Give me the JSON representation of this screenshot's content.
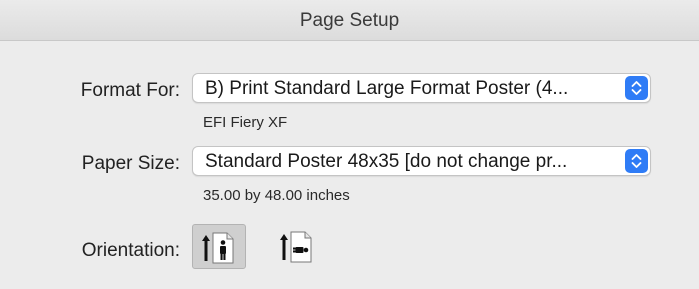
{
  "window": {
    "title": "Page Setup"
  },
  "format_for": {
    "label": "Format For:",
    "value": "B) Print Standard Large Format Poster (4...",
    "sub_text": "EFI Fiery XF"
  },
  "paper_size": {
    "label": "Paper Size:",
    "value": "Standard Poster 48x35 [do not change pr...",
    "sub_text": "35.00 by 48.00 inches"
  },
  "orientation": {
    "label": "Orientation:",
    "options": [
      {
        "name": "portrait",
        "selected": true,
        "icon": "portrait-orientation-icon"
      },
      {
        "name": "landscape",
        "selected": false,
        "icon": "landscape-orientation-icon"
      }
    ]
  },
  "colors": {
    "accent": "#2f7cf6"
  }
}
